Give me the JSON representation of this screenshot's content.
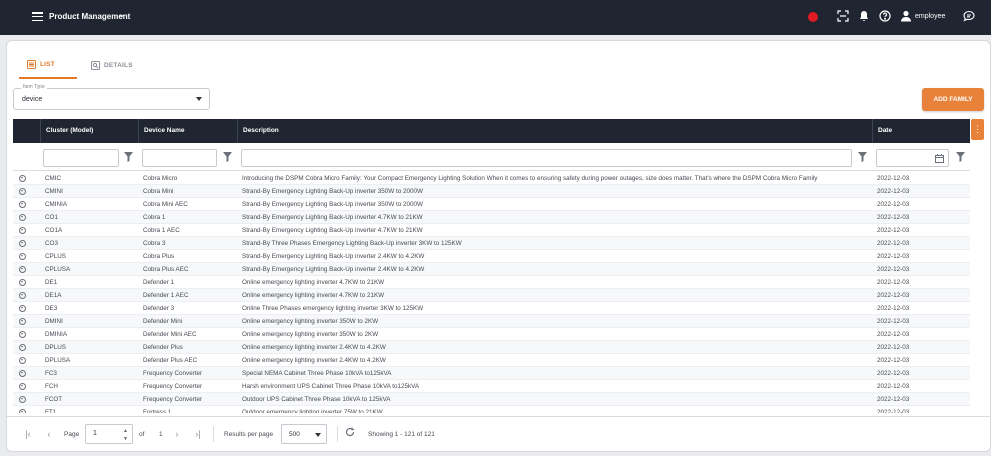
{
  "topbar": {
    "title": "Product Management",
    "user": "employee",
    "icons": [
      "menu-icon",
      "chevron-down-icon",
      "record-icon",
      "scan-icon",
      "bell-icon",
      "help-icon",
      "user-icon",
      "chat-icon"
    ]
  },
  "tabs": [
    {
      "label": "LIST",
      "icon": "list-icon",
      "active": true
    },
    {
      "label": "DETAILS",
      "icon": "details-icon",
      "active": false
    }
  ],
  "item_type": {
    "label": "Item Type",
    "value": "device"
  },
  "add_button": "ADD FAMILY",
  "columns": {
    "cluster": "Cluster (Model)",
    "device": "Device Name",
    "description": "Description",
    "date": "Date"
  },
  "rows": [
    {
      "cluster": "CMIC",
      "device": "Cobra Micro",
      "description": "Introducing the DSPM Cobra Micro Family: Your Compact Emergency Lighting Solution When it comes to ensuring safety during power outages, size does matter. That's where the DSPM Cobra Micro Family",
      "date": "2022-12-03"
    },
    {
      "cluster": "CMINI",
      "device": "Cobra Mini",
      "description": "Strand-By Emergency Lighting Back-Up inverter 350W to 2000W",
      "date": "2022-12-03"
    },
    {
      "cluster": "CMINIA",
      "device": "Cobra Mini AEC",
      "description": "Strand-By Emergency Lighting Back-Up inverter 350W to 2000W",
      "date": "2022-12-03"
    },
    {
      "cluster": "CO1",
      "device": "Cobra 1",
      "description": "Strand-By Emergency Lighting Back-Up inverter 4.7KW to 21KW",
      "date": "2022-12-03"
    },
    {
      "cluster": "CO1A",
      "device": "Cobra 1 AEC",
      "description": "Strand-By Emergency Lighting Back-Up inverter 4.7KW to 21KW",
      "date": "2022-12-03"
    },
    {
      "cluster": "CO3",
      "device": "Cobra 3",
      "description": "Strand-By Three Phases Emergency Lighting Back-Up inverter 3KW to 125KW",
      "date": "2022-12-03"
    },
    {
      "cluster": "CPLUS",
      "device": "Cobra Plus",
      "description": "Strand-By Emergency Lighting Back-Up inverter 2.4KW to 4.2KW",
      "date": "2022-12-03"
    },
    {
      "cluster": "CPLUSA",
      "device": "Cobra Plus AEC",
      "description": "Strand-By Emergency Lighting Back-Up inverter 2.4KW to 4.2KW",
      "date": "2022-12-03"
    },
    {
      "cluster": "DE1",
      "device": "Defender 1",
      "description": "Online emergency lighting inverter 4.7KW to 21KW",
      "date": "2022-12-03"
    },
    {
      "cluster": "DE1A",
      "device": "Defender 1 AEC",
      "description": "Online emergency lighting inverter 4.7KW to 21KW",
      "date": "2022-12-03"
    },
    {
      "cluster": "DE3",
      "device": "Defender 3",
      "description": "Online Three Phases emergency lighting inverter 3KW to 125KW",
      "date": "2022-12-03"
    },
    {
      "cluster": "DMINI",
      "device": "Defender Mini",
      "description": "Online emergency lighting inverter 350W to 2KW",
      "date": "2022-12-03"
    },
    {
      "cluster": "DMINIA",
      "device": "Defender Mini AEC",
      "description": "Online emergency lighting inverter 350W to 2KW",
      "date": "2022-12-03"
    },
    {
      "cluster": "DPLUS",
      "device": "Defender Plus",
      "description": "Online emergency lighting inverter 2.4KW to 4.2KW",
      "date": "2022-12-03"
    },
    {
      "cluster": "DPLUSA",
      "device": "Defender Plus AEC",
      "description": "Online emergency lighting inverter 2.4KW to 4.2KW",
      "date": "2022-12-03"
    },
    {
      "cluster": "FC3",
      "device": "Frequency Converter",
      "description": "Special NEMA Cabinet Three Phase 10kVA to125kVA",
      "date": "2022-12-03"
    },
    {
      "cluster": "FCH",
      "device": "Frequency Converter",
      "description": "Harsh environment UPS Cabinet Three Phase 10kVA to125kVA",
      "date": "2022-12-03"
    },
    {
      "cluster": "FCOT",
      "device": "Frequency Converter",
      "description": "Outdoor UPS Cabinet Three Phase 10kVA to 125kVA",
      "date": "2022-12-03"
    },
    {
      "cluster": "FT1",
      "device": "Fortress 1",
      "description": "Outdoor emergency lighting inverter 75W to 21KW",
      "date": "2022-12-03"
    }
  ],
  "pager": {
    "page_label": "Page",
    "page_value": "1",
    "of_label": "of",
    "total_pages": "1",
    "results_label": "Results per page",
    "results_value": "500",
    "showing": "Showing 1 - 121 of 121"
  }
}
